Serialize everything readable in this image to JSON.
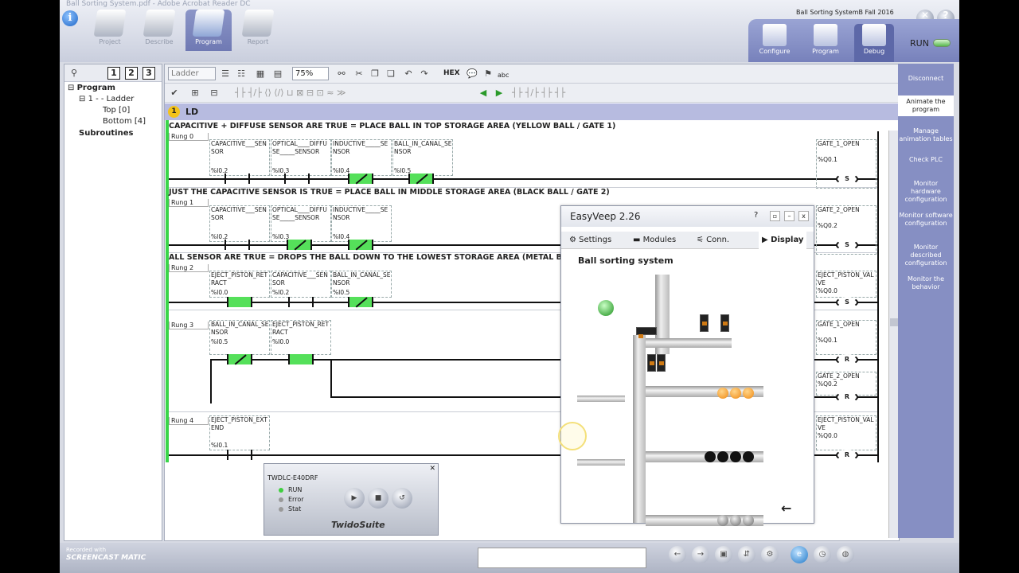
{
  "header": {
    "window_title": "Ball Sorting System.pdf - Adobe Acrobat Reader DC",
    "project_title": "Ball Sorting SystemB Fall 2016",
    "left_tabs": [
      "Project",
      "Describe",
      "Program",
      "Report"
    ],
    "right_tabs": [
      "Configure",
      "Program",
      "Debug"
    ],
    "run_label": "RUN"
  },
  "tree": {
    "numbers": [
      "1",
      "2",
      "3"
    ],
    "program": "Program",
    "ladder": "1 -  - Ladder",
    "top": "Top [0]",
    "bottom": "Bottom [4]",
    "subroutines": "Subroutines"
  },
  "toolbar": {
    "language": "Ladder",
    "zoom": "75%",
    "hex": "HEX",
    "abc": "abc"
  },
  "section": {
    "number": "1",
    "title": "LD"
  },
  "rungs": [
    {
      "comment": "CAPACITIVE + DIFFUSE SENSOR ARE TRUE = PLACE BALL IN TOP STORAGE AREA (YELLOW BALL / GATE 1)",
      "label": "Rung 0",
      "contacts": [
        {
          "name": "CAPACITIVE___SENSOR",
          "addr": "%I0.2"
        },
        {
          "name": "OPTICAL____DIFFUSE_____SENSOR",
          "addr": "%I0.3"
        },
        {
          "name": "INDUCTIVE_____SENSOR",
          "addr": "%I0.4"
        },
        {
          "name": "BALL_IN_CANAL_SENSOR",
          "addr": "%I0.5"
        }
      ],
      "coil": {
        "name": "GATE_1_OPEN",
        "addr": "%Q0.1",
        "type": "S"
      }
    },
    {
      "comment": "JUST THE CAPACITIVE SENSOR IS TRUE = PLACE BALL IN MIDDLE STORAGE AREA (BLACK BALL / GATE 2)",
      "label": "Rung 1",
      "contacts": [
        {
          "name": "CAPACITIVE___SENSOR",
          "addr": "%I0.2"
        },
        {
          "name": "OPTICAL____DIFFUSE_____SENSOR",
          "addr": "%I0.3"
        },
        {
          "name": "INDUCTIVE_____SENSOR",
          "addr": "%I0.4"
        }
      ],
      "coil": {
        "name": "GATE_2_OPEN",
        "addr": "%Q0.2",
        "type": "S"
      }
    },
    {
      "comment": "ALL SENSOR ARE TRUE = DROPS THE BALL DOWN TO THE LOWEST STORAGE AREA (METAL BALL / NO GATE)",
      "label": "Rung 2",
      "contacts": [
        {
          "name": "EJECT_PISTON_RETRACT",
          "addr": "%I0.0"
        },
        {
          "name": "CAPACITIVE___SENSOR",
          "addr": "%I0.2"
        },
        {
          "name": "BALL_IN_CANAL_SENSOR",
          "addr": "%I0.5"
        }
      ],
      "coil": {
        "name": "EJECT_PISTON_VALVE",
        "addr": "%Q0.0",
        "type": "S"
      }
    },
    {
      "comment": "",
      "label": "Rung 3",
      "contacts": [
        {
          "name": "BALL_IN_CANAL_SENSOR",
          "addr": "%I0.5"
        },
        {
          "name": "EJECT_PISTON_RETRACT",
          "addr": "%I0.0"
        }
      ],
      "coil": {
        "name": "GATE_1_OPEN",
        "addr": "%Q0.1",
        "type": "R"
      },
      "coil2": {
        "name": "GATE_2_OPEN",
        "addr": "%Q0.2",
        "type": "R"
      }
    },
    {
      "comment": "",
      "label": "Rung 4",
      "contacts": [
        {
          "name": "EJECT_PISTON_EXTEND",
          "addr": "%I0.1"
        }
      ],
      "coil": {
        "name": "EJECT_PISTON_VALVE",
        "addr": "%Q0.0",
        "type": "R"
      }
    }
  ],
  "right_panel": [
    "Disconnect",
    "Animate the program",
    "Manage animation tables",
    "Check PLC",
    "Monitor hardware configuration",
    "Monitor software configuration",
    "Monitor described configuration",
    "Monitor the behavior"
  ],
  "twido": {
    "model": "TWDLC-E40DRF",
    "leds": [
      "RUN",
      "Error",
      "Stat"
    ],
    "logo": "TwidoSuite"
  },
  "easyveep": {
    "title": "EasyVeep 2.26",
    "tabs": [
      "Settings",
      "Modules",
      "Conn.",
      "Display"
    ],
    "heading": "Ball sorting system",
    "help": "?"
  },
  "watermark": {
    "line1": "Recorded with",
    "line2": "SCREENCAST MATIC"
  }
}
